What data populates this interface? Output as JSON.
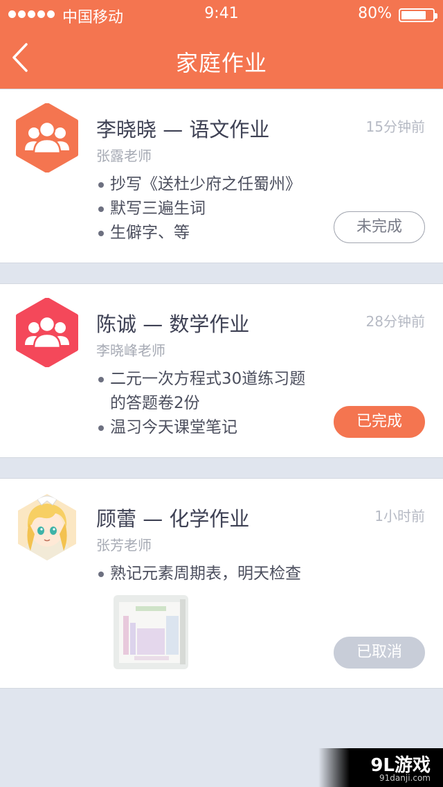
{
  "status_bar": {
    "carrier": "中国移动",
    "time": "9:41",
    "battery_percent": "80%",
    "battery_level": 0.8
  },
  "nav": {
    "title": "家庭作业",
    "back_icon": "chevron-left-icon"
  },
  "colors": {
    "brand": "#f47550",
    "avatar_chinese": "#f47550",
    "avatar_math": "#f4485a",
    "done": "#f47550",
    "cancelled": "#c8cdd8",
    "background": "#e0e5ee"
  },
  "homework": [
    {
      "title": "李晓晓 — 语文作业",
      "teacher": "张露老师",
      "time": "15分钟前",
      "avatar_icon": "group-icon",
      "tasks": [
        "抄写《送杜少府之任蜀州》",
        "默写三遍生词",
        "生僻字、等"
      ],
      "status": "未完成"
    },
    {
      "title": "陈诚 — 数学作业",
      "teacher": "李晓峰老师",
      "time": "28分钟前",
      "avatar_icon": "group-icon",
      "tasks": [
        "二元一次方程式30道练习题",
        "的答题卷2份",
        "温习今天课堂笔记"
      ],
      "status": "已完成"
    },
    {
      "title": "顾蕾 — 化学作业",
      "teacher": "张芳老师",
      "time": "1小时前",
      "avatar_icon": "anime-girl-avatar",
      "tasks": [
        "熟记元素周期表，明天检查"
      ],
      "attachment_icon": "periodic-table-photo",
      "status": "已取消"
    }
  ],
  "watermark": {
    "logo": "9L游戏",
    "url": "91danji.com"
  }
}
